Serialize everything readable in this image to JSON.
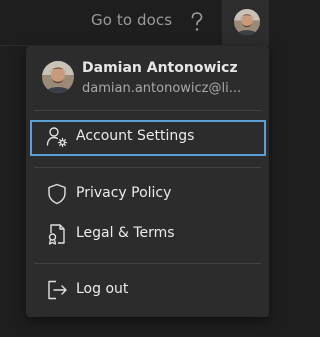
{
  "topbar": {
    "docs_label": "Go to docs",
    "help_icon": "question-mark-icon",
    "avatar_icon": "user-avatar"
  },
  "dropdown": {
    "user": {
      "name": "Damian Antonowicz",
      "email": "damian.antonowicz@li..."
    },
    "items": [
      {
        "label": "Account Settings",
        "icon": "user-settings-icon",
        "selected": true
      },
      {
        "label": "Privacy Policy",
        "icon": "shield-icon"
      },
      {
        "label": "Legal & Terms",
        "icon": "certificate-document-icon"
      },
      {
        "label": "Log out",
        "icon": "logout-icon"
      }
    ]
  },
  "colors": {
    "background": "#1e1e1e",
    "menu_background": "#2c2c2c",
    "selection_border": "#5c9fd6",
    "text_primary": "#ececec",
    "text_secondary": "#a8a8a8"
  }
}
